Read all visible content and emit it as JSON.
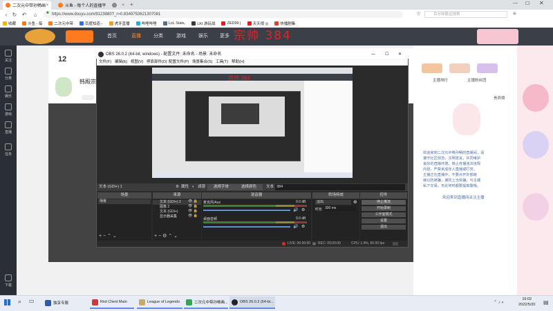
{
  "browser": {
    "tabs": [
      {
        "label": "二次元中带孙畅画",
        "active": true
      },
      {
        "label": "斗鱼 - 每个人的直播平台",
        "active": false
      },
      {
        "label": "",
        "active": false
      }
    ],
    "url": "https://www.douyu.com/9123880?_r=0.8349753621307081",
    "search_placeholder": "百分钟路径搜索",
    "bookmarks": [
      "收藏",
      "斗鱼 - 每",
      "二次元中带",
      "百度知道--",
      "虎牙直播",
      "哔哩哔哩",
      "LoL Stats,",
      "LKI 游玩战",
      "ZED99 |",
      "天天视 ◎",
      "热播剧集"
    ]
  },
  "site": {
    "nav": [
      "首页",
      "直播",
      "分类",
      "游戏",
      "娱乐",
      "更多"
    ],
    "left_bar": [
      "关注",
      "分类",
      "娱乐",
      "游戏",
      "直播",
      "任务",
      "下载"
    ],
    "streamer_title": "韩殿宗",
    "room_count": "12",
    "overlay_watermark": "宗帅 384",
    "right_panel": {
      "text_links": [
        "主播排行",
        "主播粉丝团",
        "贵宾榜"
      ],
      "chat_lines": [
        "欢迎来到二次元中带孙畅的直播间，请",
        "遵守社区规范，文明发言，共同维护",
        "良好的直播环境，禁止传播违法违规",
        "内容，严禁未成年人直播或打赏，",
        "主播正在直播中，不要点开外部链",
        "接以防被骗，谨防上当受骗，与主播",
        "私下交易，无论何时都要提高警惕。"
      ],
      "gift_text": "欢迎来到直播间关注主播"
    }
  },
  "obs": {
    "title": "OBS 26.0.2 (64-bit, windows) - 配置文件: 未命名 - 场景: 未命名",
    "menu": [
      "文件(F)",
      "编辑(E)",
      "视图(V)",
      "停靠部件(D)",
      "配置文件(P)",
      "场景集合(S)",
      "工具(T)",
      "帮助(H)"
    ],
    "toolbar": {
      "source_name": "文本 (GDI+) 1",
      "properties": "属性",
      "filters": "滤镜",
      "font": "选择字体",
      "color": "选择颜色",
      "text_label": "文本",
      "text_value": "384"
    },
    "docks": [
      "场景",
      "来源",
      "混音器",
      "转场特效",
      "控件"
    ],
    "scenes": [
      "场景"
    ],
    "sources": [
      "文本 (GDI+) 2",
      "图像 2",
      "文本 (GDI+)",
      "显示器采集"
    ],
    "mixer": [
      {
        "name": "麦克风/Aux",
        "db": "0.0 dB"
      },
      {
        "name": "桌面音频",
        "db": "0.0 dB"
      }
    ],
    "transition": {
      "type": "淡出",
      "duration_label": "时长",
      "duration": "300 ms"
    },
    "controls": [
      "停止推流",
      "开始录制",
      "工作室模式",
      "设置",
      "退出"
    ],
    "status": {
      "live": "LIVE: 00:00:00",
      "rec": "REC: 00:00:00",
      "cpu": "CPU: 1.4%, 60.00 fps"
    }
  },
  "taskbar": {
    "items": [
      "独享专服",
      "Riot Client Main",
      "League of Legends",
      "二次元中带孙畅画...",
      "OBS 26.0.2 (64-bi..."
    ],
    "time": "16:02",
    "date": "2022/5/20"
  },
  "colors": {
    "accent": "#e0232a",
    "obs_bg": "#2b2b2b",
    "taskbar": "#e8edf5"
  }
}
